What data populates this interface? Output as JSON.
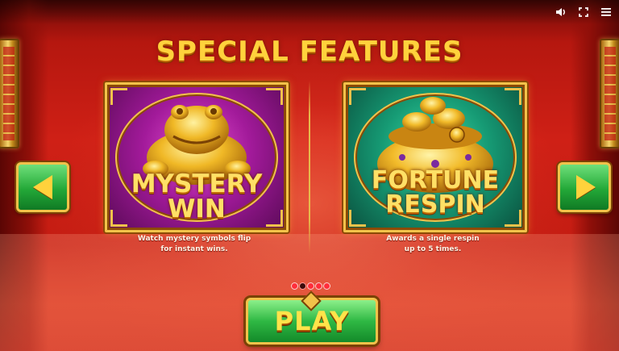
{
  "screen": {
    "title": "SPECIAL FEATURES"
  },
  "topbar": {
    "sound_icon": "speaker-icon",
    "fullscreen_icon": "fullscreen-icon",
    "menu_icon": "hamburger-menu-icon"
  },
  "features": [
    {
      "title_line1": "MYSTERY",
      "title_line2": "WIN",
      "description_line1": "Watch mystery symbols flip",
      "description_line2": "for instant wins.",
      "artwork": "golden-toad",
      "background_color": "#a21a9a"
    },
    {
      "title_line1": "FORTUNE",
      "title_line2": "RESPIN",
      "description_line1": "Awards a single respin",
      "description_line2": "up to 5 times.",
      "artwork": "golden-treasure-pot",
      "background_color": "#169a74"
    }
  ],
  "navigation": {
    "prev_icon": "arrow-left-icon",
    "next_icon": "arrow-right-icon",
    "pages_total": 5,
    "active_page": 2
  },
  "play_button": {
    "label": "PLAY"
  },
  "colors": {
    "title_gold": "#ffd23c",
    "button_green": "#2fb844",
    "background_red": "#cf2016"
  }
}
